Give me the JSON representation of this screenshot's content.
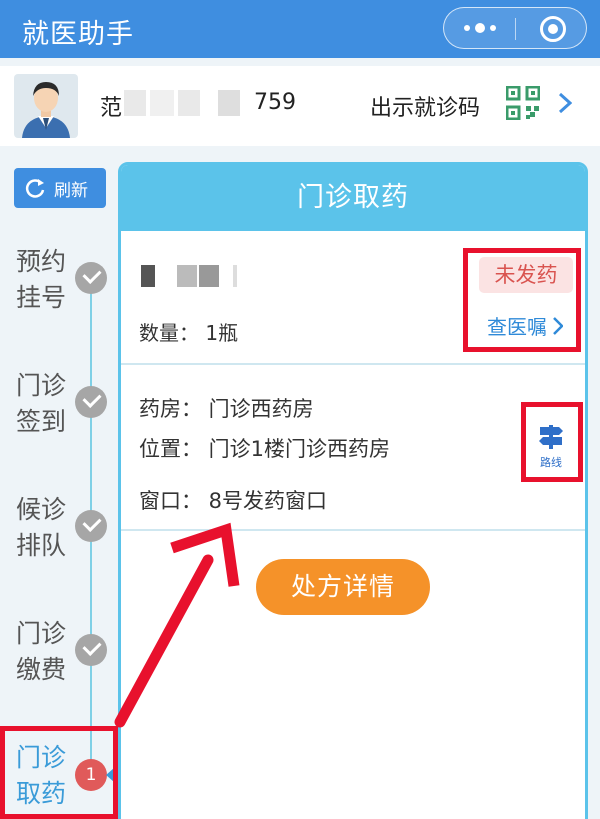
{
  "app": {
    "title": "就医助手"
  },
  "patient": {
    "name_prefix": "范",
    "name_suffix": "759",
    "show_code_label": "出示就诊码"
  },
  "sidebar": {
    "refresh_label": "刷新",
    "steps": [
      {
        "label": "预约挂号",
        "state": "done"
      },
      {
        "label": "门诊签到",
        "state": "done"
      },
      {
        "label": "候诊排队",
        "state": "done"
      },
      {
        "label": "门诊缴费",
        "state": "done"
      },
      {
        "label": "门诊取药",
        "state": "active",
        "badge": "1"
      }
    ]
  },
  "card": {
    "title": "门诊取药",
    "medicine": {
      "quantity": "数量：  1瓶",
      "status": "未发药",
      "advice_link": "查医嘱"
    },
    "pharmacy": {
      "pharmacy_line": "药房：  门诊西药房",
      "location_line": "位置：  门诊1楼门诊西药房",
      "window_line": "窗口：  8号发药窗口",
      "route_label": "路线"
    },
    "detail_button": "处方详情"
  },
  "colors": {
    "header_blue": "#3f8ee0",
    "card_blue": "#5bc3ea",
    "orange": "#f59229",
    "red_annotation": "#e8112d"
  }
}
